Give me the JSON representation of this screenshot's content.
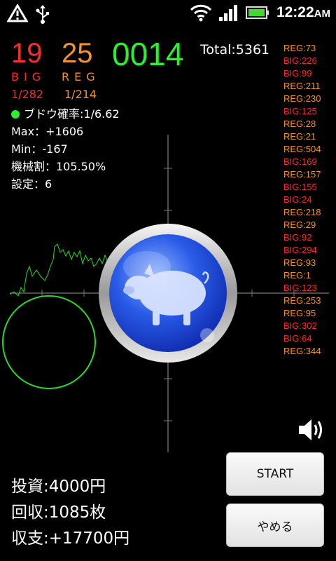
{
  "status_bar": {
    "time": "12:22",
    "ampm": "AM"
  },
  "counters": {
    "big": "19",
    "reg": "25",
    "games": "0014",
    "big_label": "BIG",
    "reg_label": "REG",
    "big_prob": "1/282",
    "reg_prob": "1/214",
    "total": "Total:5361"
  },
  "stats": {
    "grape": "ブドウ確率:1/6.62",
    "max": "Max：+1606",
    "min": "Min：-167",
    "payout": "機械割：105.50%",
    "setting": "設定：6"
  },
  "history": [
    "REG:73",
    "BIG:226",
    "BIG:99",
    "REG:211",
    "REG:230",
    "BIG:125",
    "REG:28",
    "REG:21",
    "REG:504",
    "BIG:169",
    "REG:157",
    "BIG:155",
    "BIG:24",
    "REG:218",
    "REG:29",
    "BIG:92",
    "BIG:294",
    "REG:93",
    "REG:1",
    "BIG:123",
    "REG:253",
    "REG:95",
    "BIG:302",
    "BIG:64",
    "REG:344"
  ],
  "money": {
    "invest": "投資:4000円",
    "collect": "回収:1085枚",
    "balance": "収支:+17700円"
  },
  "buttons": {
    "start": "START",
    "quit": "やめる"
  },
  "colors": {
    "big": "#ff2a2a",
    "reg": "#f2942c",
    "games": "#2cf02c"
  },
  "icons": [
    "warning-icon",
    "usb-icon",
    "wifi-icon",
    "signal-icon",
    "battery-icon",
    "pig-icon",
    "speaker-icon"
  ]
}
